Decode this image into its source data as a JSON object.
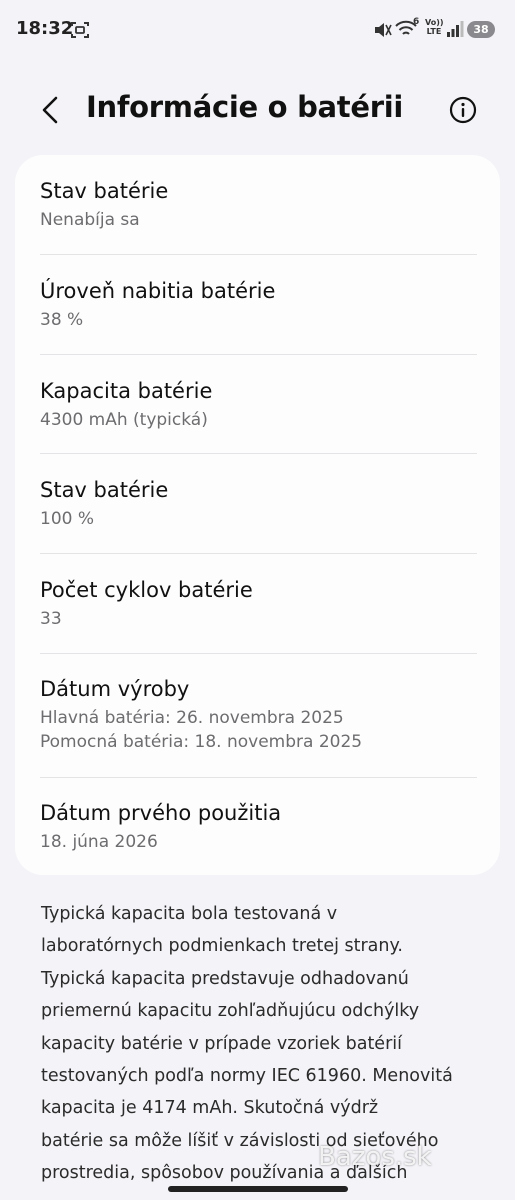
{
  "status_bar": {
    "time": "18:32",
    "battery_level": "38",
    "icons": [
      "screenshot-icon",
      "mute-icon",
      "wifi-icon",
      "volte-icon",
      "signal-icon",
      "battery-icon"
    ],
    "wifi_badge": "6",
    "volte_top": "Vo))",
    "volte_bottom": "LTE"
  },
  "header": {
    "title": "Informácie o batérii"
  },
  "items": [
    {
      "title": "Stav batérie",
      "sub": [
        "Nenabíja sa"
      ]
    },
    {
      "title": "Úroveň nabitia batérie",
      "sub": [
        "38 %"
      ]
    },
    {
      "title": "Kapacita batérie",
      "sub": [
        "4300 mAh (typická)"
      ]
    },
    {
      "title": "Stav batérie",
      "sub": [
        "100 %"
      ]
    },
    {
      "title": "Počet cyklov batérie",
      "sub": [
        "33"
      ]
    },
    {
      "title": "Dátum výroby",
      "sub": [
        "Hlavná batéria: 26. novembra 2025",
        "Pomocná batéria: 18. novembra 2025"
      ]
    },
    {
      "title": "Dátum prvého použitia",
      "sub": [
        "18. júna 2026"
      ]
    }
  ],
  "description_lines": [
    "Typická kapacita bola testovaná v",
    "laboratórnych podmienkach tretej strany.",
    "Typická kapacita predstavuje odhadovanú",
    "priemernú kapacitu zohľadňujúcu odchýlky",
    "kapacity batérie v prípade vzoriek batérií",
    "testovaných podľa normy IEC 61960. Menovitá",
    "kapacita je 4174 mAh. Skutočná výdrž",
    "batérie sa môže líšiť v závislosti od sieťového",
    "prostredia, spôsobov používania a ďalších"
  ],
  "watermark": "Bazos.sk",
  "colors": {
    "background": "#f4f3f8",
    "card": "#fdfdfd",
    "secondary_text": "#6d6d70"
  }
}
